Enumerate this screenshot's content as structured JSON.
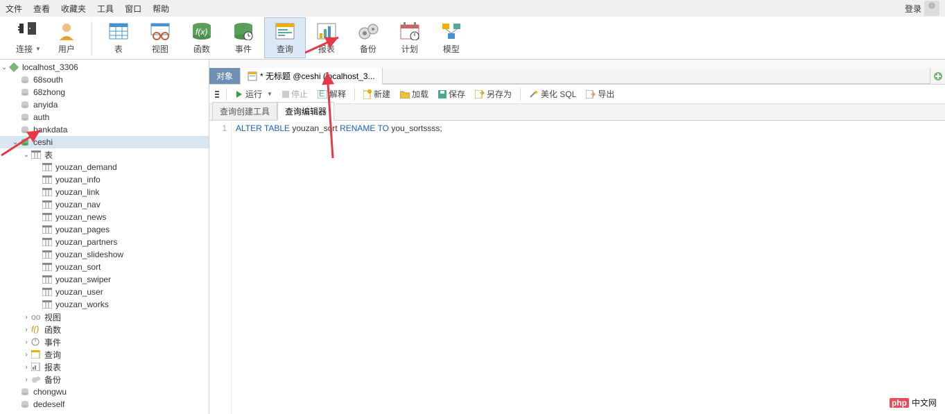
{
  "menu": {
    "items": [
      "文件",
      "查看",
      "收藏夹",
      "工具",
      "窗口",
      "帮助"
    ],
    "login": "登录"
  },
  "toolbar": {
    "items": [
      {
        "id": "connection",
        "label": "连接",
        "dropdown": true
      },
      {
        "id": "user",
        "label": "用户"
      },
      {
        "sep": true
      },
      {
        "id": "table",
        "label": "表"
      },
      {
        "id": "view",
        "label": "视图"
      },
      {
        "id": "function",
        "label": "函数"
      },
      {
        "id": "event",
        "label": "事件"
      },
      {
        "id": "query",
        "label": "查询",
        "selected": true
      },
      {
        "id": "report",
        "label": "报表"
      },
      {
        "id": "backup",
        "label": "备份"
      },
      {
        "id": "schedule",
        "label": "计划"
      },
      {
        "id": "model",
        "label": "模型"
      }
    ]
  },
  "sidebar": {
    "root": {
      "connection": "localhost_3306"
    },
    "databases": [
      "68south",
      "68zhong",
      "anyida",
      "auth",
      "bankdata"
    ],
    "active_db": "ceshi",
    "tables_folder": "表",
    "tables": [
      "youzan_demand",
      "youzan_info",
      "youzan_link",
      "youzan_nav",
      "youzan_news",
      "youzan_pages",
      "youzan_partners",
      "youzan_slideshow",
      "youzan_sort",
      "youzan_swiper",
      "youzan_user",
      "youzan_works"
    ],
    "folders": [
      {
        "label": "视图",
        "icon": "view"
      },
      {
        "label": "函数",
        "icon": "fx"
      },
      {
        "label": "事件",
        "icon": "event"
      },
      {
        "label": "查询",
        "icon": "query"
      },
      {
        "label": "报表",
        "icon": "report"
      },
      {
        "label": "备份",
        "icon": "backup"
      }
    ],
    "more_dbs": [
      "chongwu",
      "dedeself"
    ]
  },
  "tabs": {
    "objects": "对象",
    "current": "* 无标题 @ceshi (localhost_3..."
  },
  "actions": {
    "run": "运行",
    "stop": "停止",
    "explain": "解释",
    "new": "新建",
    "load": "加载",
    "save": "保存",
    "saveas": "另存为",
    "beautify": "美化 SQL",
    "export": "导出"
  },
  "sub_tabs": {
    "builder": "查询创建工具",
    "editor": "查询编辑器"
  },
  "sql": {
    "line": "1",
    "tokens": [
      {
        "t": "ALTER",
        "c": "kw-blue"
      },
      {
        "t": " ",
        "c": "kw-txt"
      },
      {
        "t": "TABLE",
        "c": "kw-blue"
      },
      {
        "t": " youzan_sort ",
        "c": "kw-id"
      },
      {
        "t": "RENAME",
        "c": "kw-blue"
      },
      {
        "t": " ",
        "c": "kw-txt"
      },
      {
        "t": "TO",
        "c": "kw-blue"
      },
      {
        "t": " you_sortssss",
        "c": "kw-id"
      },
      {
        "t": ";",
        "c": "kw-txt"
      }
    ]
  },
  "brand": "中文网"
}
